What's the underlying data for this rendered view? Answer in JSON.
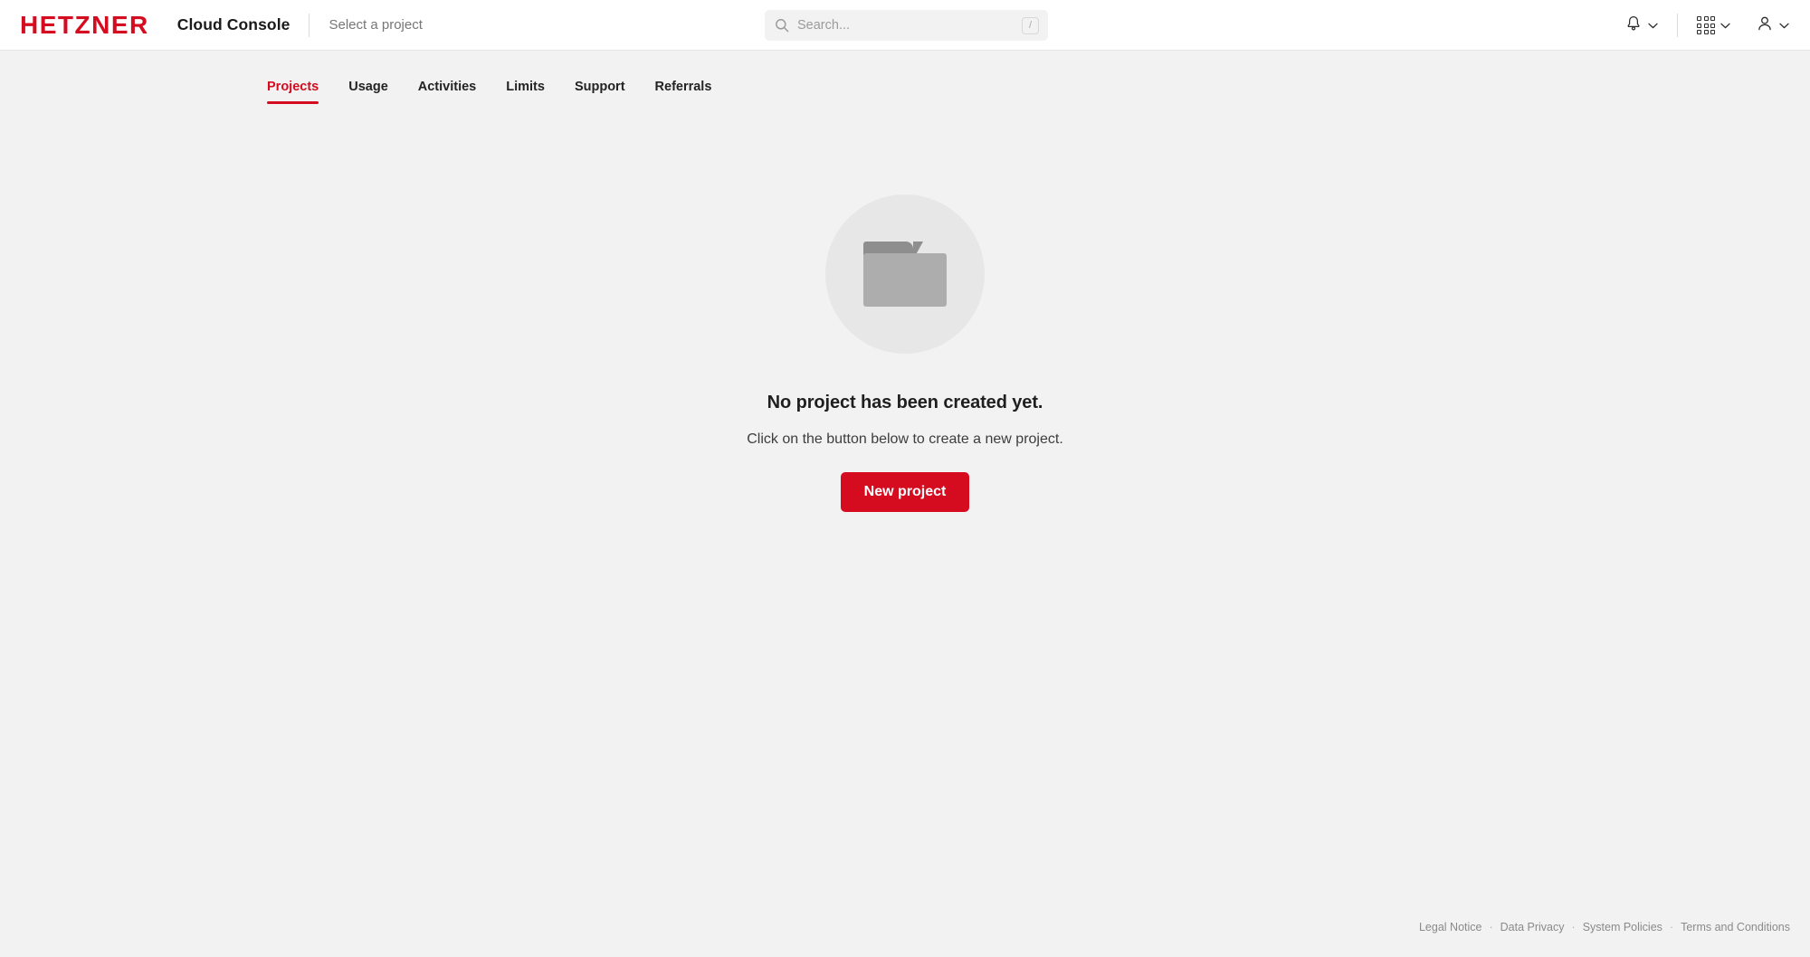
{
  "header": {
    "logo_text": "HETZNER",
    "app_title": "Cloud Console",
    "project_selector": "Select a project",
    "search": {
      "placeholder": "Search...",
      "value": "",
      "shortcut_key": "/",
      "icon": "search-icon"
    },
    "actions": [
      {
        "name": "notifications",
        "icon": "bell-icon",
        "chevron": "chevron-down-icon"
      },
      {
        "name": "apps",
        "icon": "grid-icon",
        "chevron": "chevron-down-icon"
      },
      {
        "name": "account",
        "icon": "user-icon",
        "chevron": "chevron-down-icon"
      }
    ]
  },
  "tabs": [
    {
      "label": "Projects",
      "active": true
    },
    {
      "label": "Usage",
      "active": false
    },
    {
      "label": "Activities",
      "active": false
    },
    {
      "label": "Limits",
      "active": false
    },
    {
      "label": "Support",
      "active": false
    },
    {
      "label": "Referrals",
      "active": false
    }
  ],
  "empty_state": {
    "illustration_icon": "folder-icon",
    "title": "No project has been created yet.",
    "subtitle": "Click on the button below to create a new project.",
    "button_label": "New project"
  },
  "footer": {
    "separator": "·",
    "links": [
      "Legal Notice",
      "Data Privacy",
      "System Policies",
      "Terms and Conditions"
    ]
  },
  "colors": {
    "brand_red": "#d50c1f",
    "header_bg": "#ffffff",
    "body_bg": "#f2f2f2",
    "empty_circle": "#e7e7e7",
    "folder_front": "#adadad",
    "folder_back": "#8e8e8e",
    "text_dark": "#1f1f1f",
    "text_muted": "#8a8a8a"
  }
}
